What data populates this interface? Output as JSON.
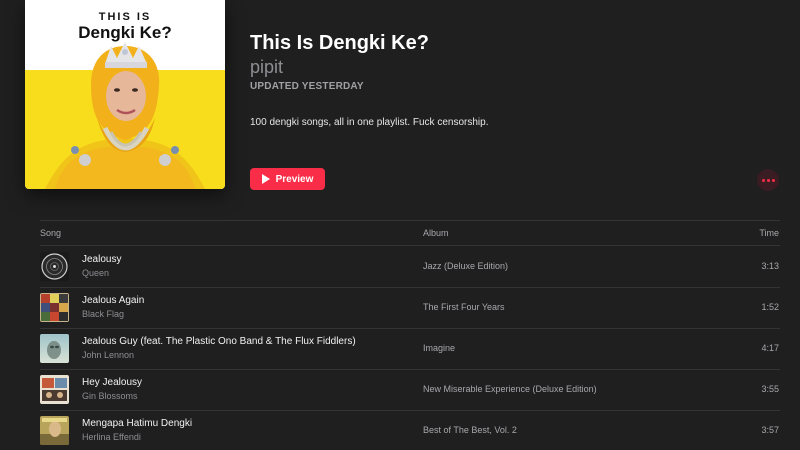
{
  "cover": {
    "kicker": "THIS IS",
    "title": "Dengki Ke?"
  },
  "playlist": {
    "title": "This Is Dengki Ke?",
    "curator": "pipit",
    "updated": "UPDATED YESTERDAY",
    "description": "100 dengki songs, all in one playlist. Fuck censorship.",
    "preview_label": "Preview",
    "more_icon": "ellipsis-icon",
    "play_icon": "play-icon"
  },
  "colors": {
    "background": "#1f1f1f",
    "accent": "#fa2d48",
    "cover_yellow": "#f7dd1b"
  },
  "table": {
    "headers": {
      "song": "Song",
      "album": "Album",
      "time": "Time"
    },
    "rows": [
      {
        "title": "Jealousy",
        "artist": "Queen",
        "album": "Jazz (Deluxe Edition)",
        "time": "3:13"
      },
      {
        "title": "Jealous Again",
        "artist": "Black Flag",
        "album": "The First Four Years",
        "time": "1:52"
      },
      {
        "title": "Jealous Guy (feat. The Plastic Ono Band & The Flux Fiddlers)",
        "artist": "John Lennon",
        "album": "Imagine",
        "time": "4:17"
      },
      {
        "title": "Hey Jealousy",
        "artist": "Gin Blossoms",
        "album": "New Miserable Experience (Deluxe Edition)",
        "time": "3:55"
      },
      {
        "title": "Mengapa Hatimu Dengki",
        "artist": "Herlina Effendi",
        "album": "Best of The Best, Vol. 2",
        "time": "3:57"
      }
    ]
  }
}
